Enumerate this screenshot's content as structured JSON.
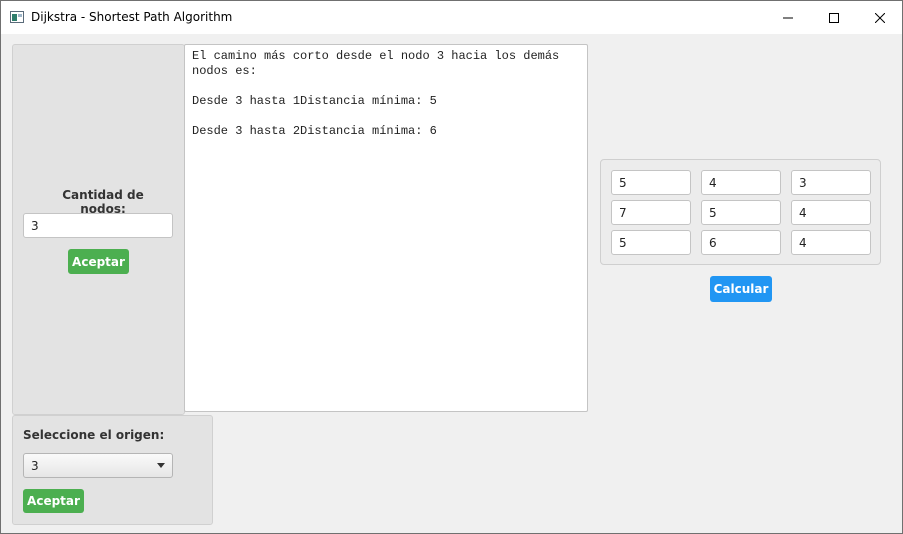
{
  "window": {
    "title": "Dijkstra - Shortest Path Algorithm",
    "icon": "java-app-icon"
  },
  "left_panel": {
    "nodes_label": "Cantidad de nodos:",
    "nodes_value": "3",
    "accept_label": "Aceptar"
  },
  "result": {
    "text": "El camino más corto desde el nodo 3 hacia los demás\nnodos es:\n\nDesde 3 hasta 1Distancia mínima: 5\n\nDesde 3 hasta 2Distancia mínima: 6"
  },
  "matrix": {
    "rows": [
      [
        "5",
        "4",
        "3"
      ],
      [
        "7",
        "5",
        "4"
      ],
      [
        "5",
        "6",
        "4"
      ]
    ],
    "calculate_label": "Calcular"
  },
  "origin_panel": {
    "label": "Seleccione el origen:",
    "selected": "3",
    "accept_label": "Aceptar"
  },
  "colors": {
    "accept_green": "#4caf50",
    "calculate_blue": "#2196f3"
  }
}
